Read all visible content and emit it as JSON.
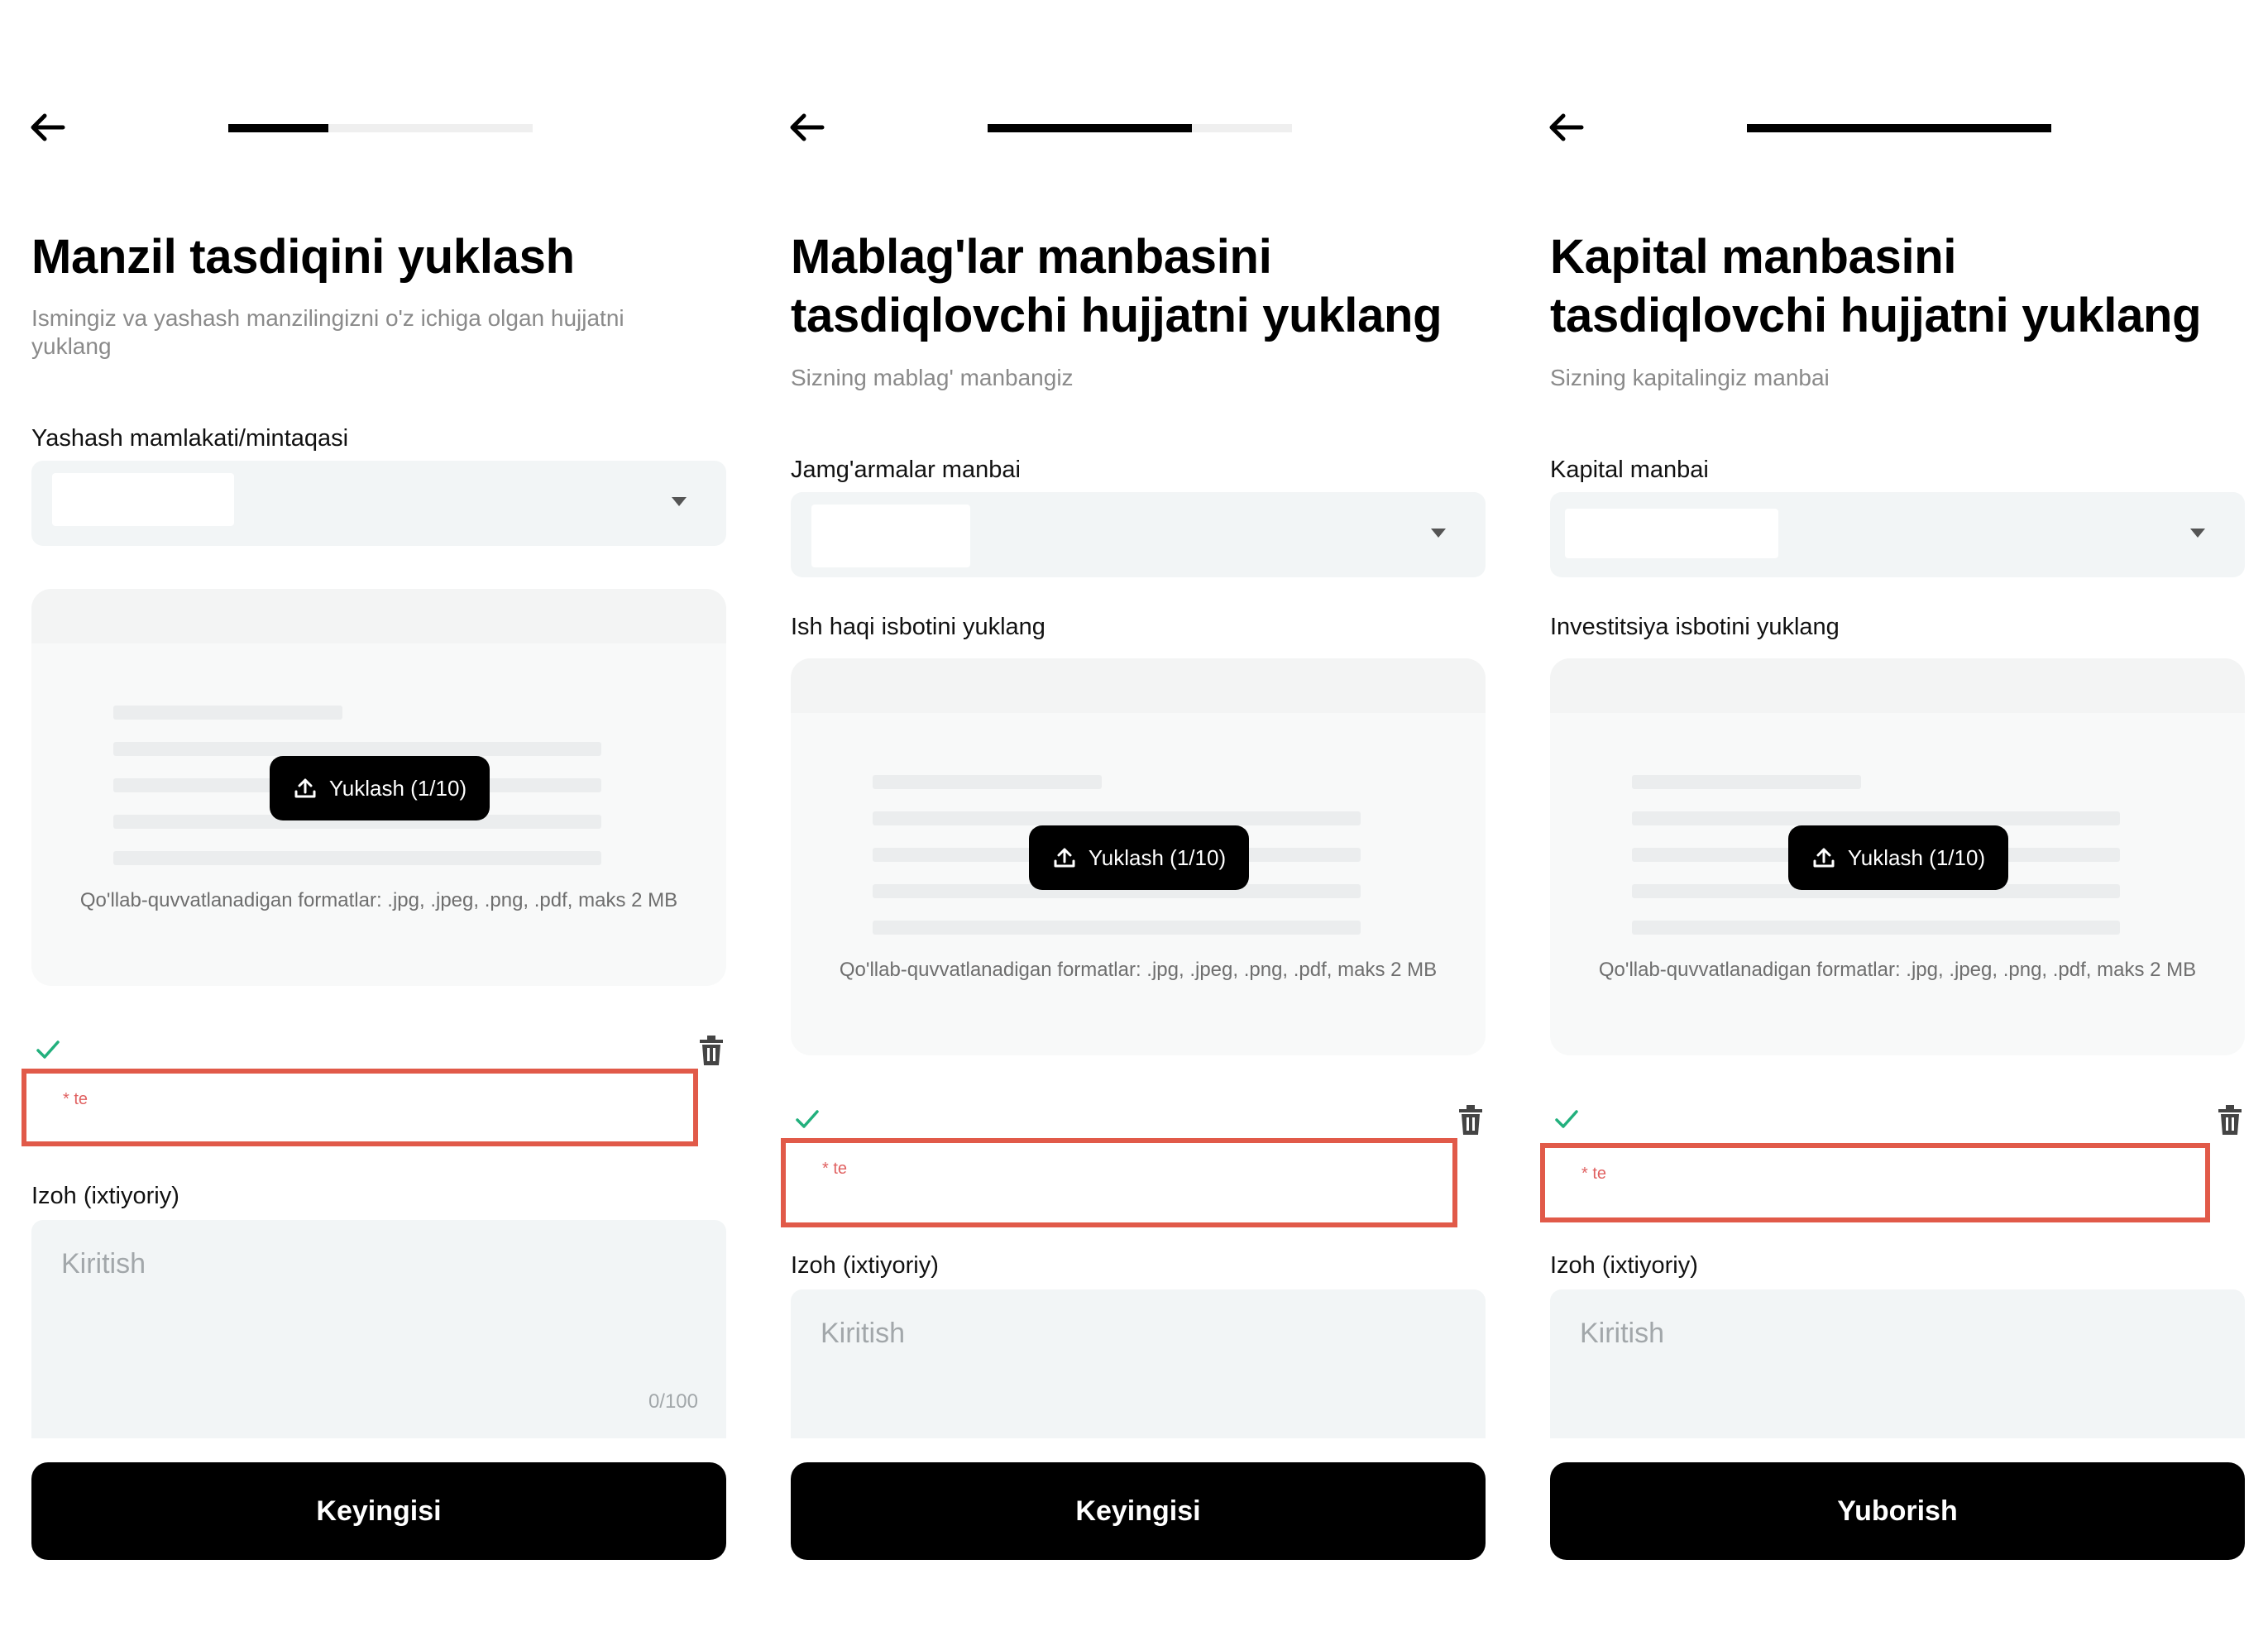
{
  "screens": [
    {
      "title": "Manzil tasdiqini yuklash",
      "subtitle": "Ismingiz va yashash manzilingizni o'z ichiga olgan hujjatni yuklang",
      "select_label": "Yashash mamlakati/mintaqasi",
      "upload_label": "",
      "upload_button": "Yuklash (1/10)",
      "formats": "Qo'llab-quvvatlanadigan formatlar: .jpg, .jpeg, .png, .pdf, maks 2 MB",
      "file_name": "* te",
      "comment_label": "Izoh (ixtiyoriy)",
      "comment_placeholder": "Kiritish",
      "counter": "0/100",
      "button": "Keyingisi",
      "progress": 0.33
    },
    {
      "title": "Mablag'lar manbasini tasdiqlovchi hujjatni yuklang",
      "subtitle": "Sizning mablag' manbangiz",
      "select_label": "Jamg'armalar manbai",
      "upload_label": "Ish haqi isbotini yuklang",
      "upload_button": "Yuklash (1/10)",
      "formats": "Qo'llab-quvvatlanadigan formatlar: .jpg, .jpeg, .png, .pdf, maks 2 MB",
      "file_name": "* te",
      "comment_label": "Izoh (ixtiyoriy)",
      "comment_placeholder": "Kiritish",
      "counter": "",
      "button": "Keyingisi",
      "progress": 0.67
    },
    {
      "title": "Kapital manbasini tasdiqlovchi hujjatni yuklang",
      "subtitle": "Sizning kapitalingiz manbai",
      "select_label": "Kapital manbai",
      "upload_label": "Investitsiya isbotini yuklang",
      "upload_button": "Yuklash (1/10)",
      "formats": "Qo'llab-quvvatlanadigan formatlar: .jpg, .jpeg, .png, .pdf, maks 2 MB",
      "file_name": "* te",
      "comment_label": "Izoh (ixtiyoriy)",
      "comment_placeholder": "Kiritish",
      "counter": "",
      "button": "Yuborish",
      "progress": 1.0
    }
  ],
  "colors": {
    "accent": "#000000",
    "field_bg": "#f2f5f6",
    "highlight": "#e15a49",
    "check": "#22b07d",
    "muted": "#8a8a8a"
  },
  "icons": [
    "arrow-left-icon",
    "chevron-down-icon",
    "upload-icon",
    "check-icon",
    "trash-icon"
  ]
}
